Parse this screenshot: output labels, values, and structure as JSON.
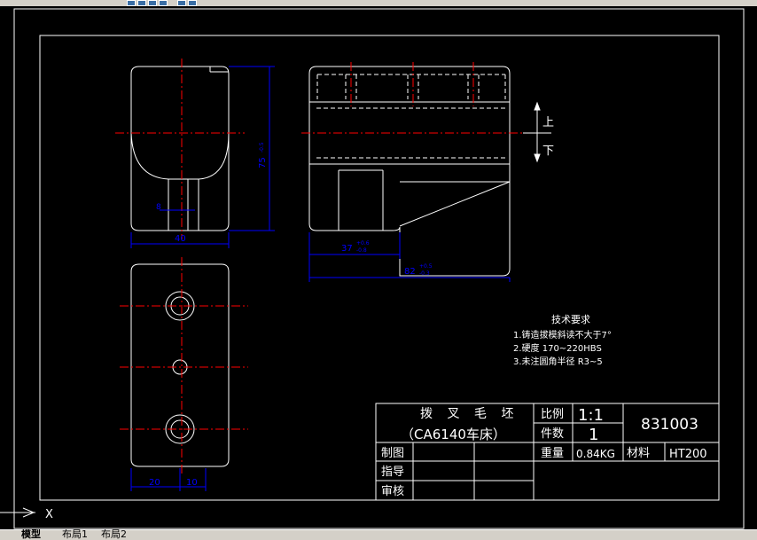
{
  "drawing": {
    "part_name": "拨 叉 毛 坯",
    "machine": "（CA6140车床）",
    "scale_label": "比例",
    "scale_value": "1:1",
    "qty_label": "件数",
    "qty_value": "1",
    "weight_label": "重量",
    "weight_value": "0.84KG",
    "material_label": "材料",
    "material_value": "HT200",
    "drawing_no": "831003",
    "drawn_label": "制图",
    "checked_label": "指导",
    "approved_label": "审核"
  },
  "tech_req": {
    "title": "技术要求",
    "items": [
      "1.铸造拔模斜读不大于7°",
      "2.硬度 170~220HBS",
      "3.未注圆角半径 R3~5"
    ]
  },
  "dims": {
    "height_75": "75",
    "height_75_tol": "-0.5",
    "width_40": "40",
    "slot_8": "8",
    "len_37": "37",
    "len_37_tol_up": "+0.6",
    "len_37_tol_dn": "-0.8",
    "len_82": "82",
    "len_82_tol_up": "+0.5",
    "len_82_tol_dn": "-0.3",
    "bottom_20": "20",
    "bottom_10": "10"
  },
  "direction": {
    "up": "上",
    "down": "下"
  },
  "ucs": {
    "axis": "X"
  },
  "tabs": [
    "模型",
    "布局1",
    "布局2"
  ],
  "colors": {
    "outline": "#ffffff",
    "center": "#ff0000",
    "dimension": "#0000ff",
    "hidden": "#ffffff"
  }
}
